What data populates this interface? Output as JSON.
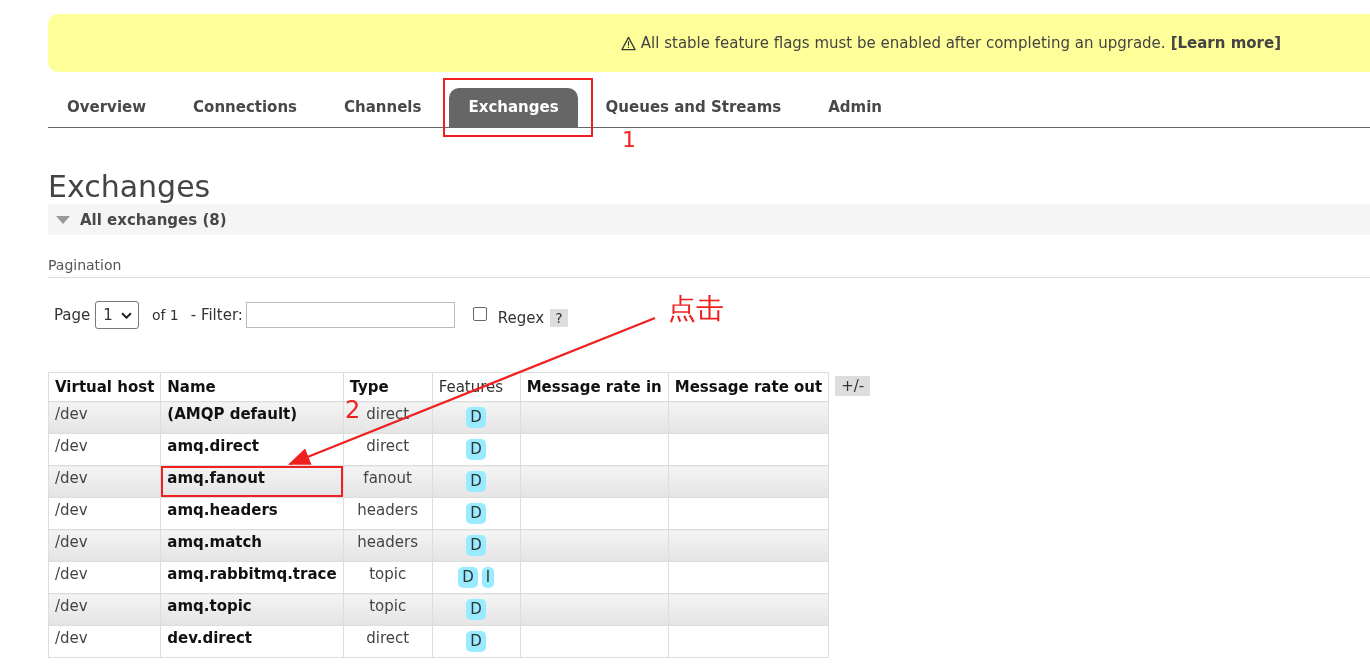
{
  "banner": {
    "text": "All stable feature flags must be enabled after completing an upgrade.",
    "link": "[Learn more]"
  },
  "tabs": [
    {
      "label": "Overview",
      "selected": false,
      "highlighted": false
    },
    {
      "label": "Connections",
      "selected": false,
      "highlighted": false
    },
    {
      "label": "Channels",
      "selected": false,
      "highlighted": false
    },
    {
      "label": "Exchanges",
      "selected": true,
      "highlighted": true
    },
    {
      "label": "Queues and Streams",
      "selected": false,
      "highlighted": false
    },
    {
      "label": "Admin",
      "selected": false,
      "highlighted": false
    }
  ],
  "heading": "Exchanges",
  "section": {
    "title": "All exchanges (8)",
    "expanded": true
  },
  "pagination": {
    "title": "Pagination",
    "page_label": "Page",
    "page_value": "1",
    "of_text": "of 1",
    "filter_label": "- Filter:",
    "regex_label": "Regex",
    "regex_checked": false,
    "help": "?"
  },
  "table": {
    "columns": [
      "Virtual host",
      "Name",
      "Type",
      "Features",
      "Message rate in",
      "Message rate out"
    ],
    "toggle": "+/-",
    "rows": [
      {
        "vhost": "/dev",
        "name": "(AMQP default)",
        "type": "direct",
        "features": [
          "D"
        ],
        "highlighted": false
      },
      {
        "vhost": "/dev",
        "name": "amq.direct",
        "type": "direct",
        "features": [
          "D"
        ],
        "highlighted": false
      },
      {
        "vhost": "/dev",
        "name": "amq.fanout",
        "type": "fanout",
        "features": [
          "D"
        ],
        "highlighted": true
      },
      {
        "vhost": "/dev",
        "name": "amq.headers",
        "type": "headers",
        "features": [
          "D"
        ],
        "highlighted": false
      },
      {
        "vhost": "/dev",
        "name": "amq.match",
        "type": "headers",
        "features": [
          "D"
        ],
        "highlighted": false
      },
      {
        "vhost": "/dev",
        "name": "amq.rabbitmq.trace",
        "type": "topic",
        "features": [
          "D",
          "I"
        ],
        "highlighted": false
      },
      {
        "vhost": "/dev",
        "name": "amq.topic",
        "type": "topic",
        "features": [
          "D"
        ],
        "highlighted": false
      },
      {
        "vhost": "/dev",
        "name": "dev.direct",
        "type": "direct",
        "features": [
          "D"
        ],
        "highlighted": false
      }
    ]
  },
  "annotations": {
    "step_1": "1",
    "step_2": "2",
    "click_note": "点击"
  }
}
